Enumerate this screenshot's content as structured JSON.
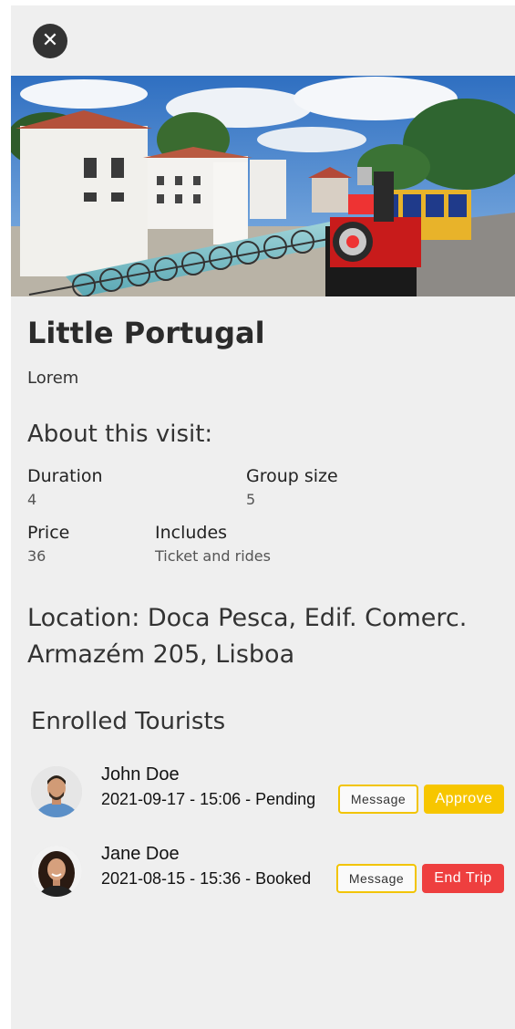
{
  "header": {
    "close_icon": "close-icon"
  },
  "hero": {
    "image_alt": "Photo of Little Portugal park with a tourist train"
  },
  "visit": {
    "title": "Little Portugal",
    "subtitle": "Lorem",
    "about_heading": "About this visit:",
    "duration_label": "Duration",
    "duration_value": "4",
    "group_label": "Group size",
    "group_value": "5",
    "price_label": "Price",
    "price_value": "36",
    "includes_label": "Includes",
    "includes_value": "Ticket and rides",
    "location": "Location: Doca Pesca, Edif. Comerc. Armazém 205, Lisboa"
  },
  "enrolled": {
    "heading": "Enrolled Tourists",
    "tourists": [
      {
        "name": "John Doe",
        "detail": "2021-09-17 - 15:06 - Pending",
        "message_label": "Message",
        "action_label": "Approve"
      },
      {
        "name": "Jane Doe",
        "detail": "2021-08-15 - 15:36 - Booked",
        "message_label": "Message",
        "action_label": "End Trip"
      }
    ]
  },
  "colors": {
    "approve": "#f7c600",
    "end_trip": "#ee3f3f",
    "message_border": "#f2c400",
    "close_button": "#333333"
  }
}
